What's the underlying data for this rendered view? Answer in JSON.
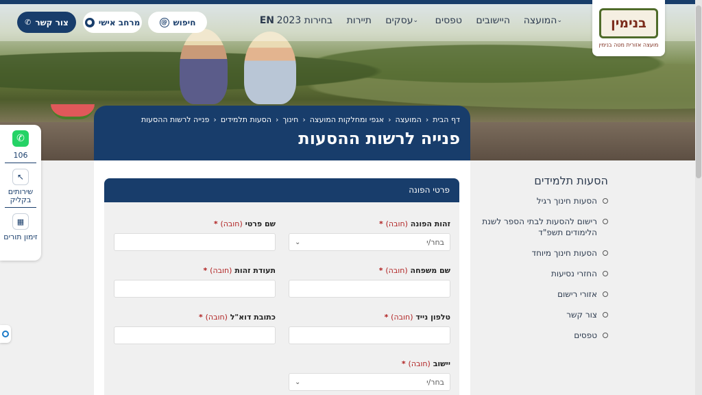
{
  "header": {
    "logo_text": "בנימין",
    "logo_sub": "מועצה אזורית מטה בנימין",
    "menu": [
      "המועצה",
      "היישובים",
      "טפסים",
      "עסקים",
      "תיירות",
      "בחירות 2023",
      "EN"
    ],
    "search_label": "חיפוש",
    "personal_area_label": "מרחב אישי",
    "contact_label": "צור קשר"
  },
  "breadcrumb": [
    "דף הבית",
    "המועצה",
    "אגפי ומחלקות המועצה",
    "חינוך",
    "הסעות תלמידים",
    "פנייה לרשות ההסעות"
  ],
  "page_title": "פנייה לרשות ההסעות",
  "side_nav": {
    "title": "הסעות תלמידים",
    "items": [
      "הסעות חינוך רגיל",
      "רישום להסעות לבתי הספר לשנת הלימודים תשפ\"ד",
      "הסעות חינוך מיוחד",
      "החזרי נסיעות",
      "אזורי רישום",
      "צור קשר",
      "טפסים"
    ]
  },
  "floating": {
    "whatsapp_number": "106",
    "click_services": "שירותים בקליק",
    "appointments": "זימון תורים"
  },
  "form": {
    "section_title": "פרטי הפונה",
    "required_word": "(חובה)",
    "select_placeholder": "בחר/י",
    "fields": {
      "applicant_id": "זהות הפונה",
      "first_name": "שם פרטי",
      "last_name": "שם משפחה",
      "id_number": "תעודת זהות",
      "mobile": "טלפון נייד",
      "email": "כתובת דוא\"ל",
      "settlement": "יישוב"
    }
  },
  "colors": {
    "brand": "#183d6b",
    "required": "#b02020"
  }
}
